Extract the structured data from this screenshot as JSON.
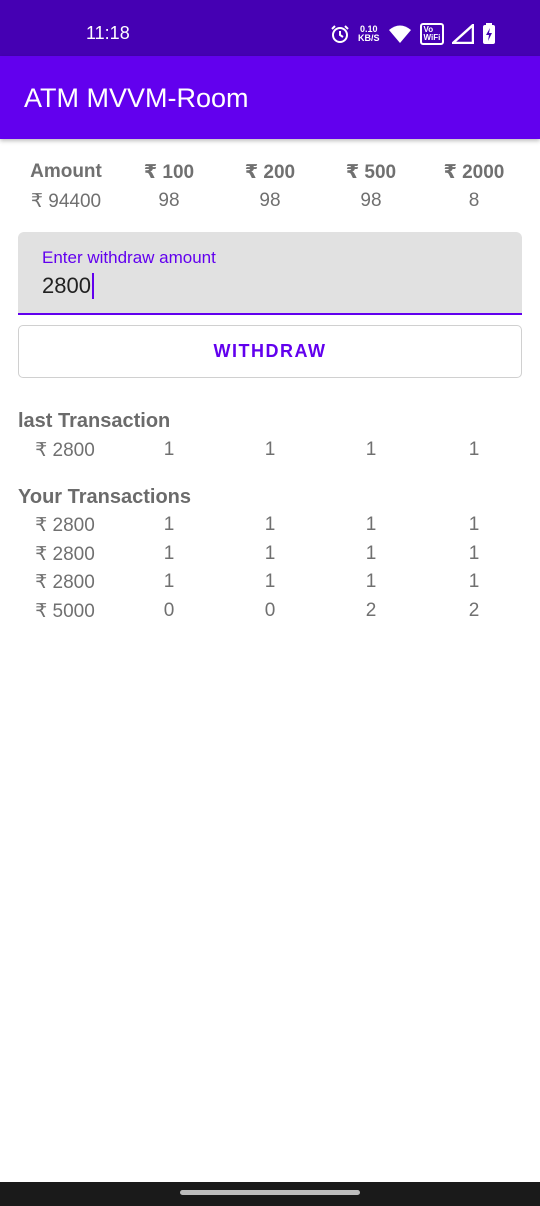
{
  "status_bar": {
    "time": "11:18",
    "net_speed_value": "0.10",
    "net_speed_unit": "KB/S",
    "vowifi_top": "Vo",
    "vowifi_bottom": "WiFi"
  },
  "app_bar": {
    "title": "ATM MVVM-Room"
  },
  "header": {
    "columns": [
      "Amount",
      "₹ 100",
      "₹ 200",
      "₹ 500",
      "₹ 2000"
    ],
    "values": [
      "₹ 94400",
      "98",
      "98",
      "98",
      "8"
    ]
  },
  "withdraw_input": {
    "label": "Enter withdraw amount",
    "value": "2800"
  },
  "withdraw_button": {
    "label": "WITHDRAW"
  },
  "last_transaction": {
    "title": "last Transaction",
    "row": [
      "₹ 2800",
      "1",
      "1",
      "1",
      "1"
    ]
  },
  "your_transactions": {
    "title": "Your Transactions",
    "rows": [
      [
        "₹ 2800",
        "1",
        "1",
        "1",
        "1"
      ],
      [
        "₹ 2800",
        "1",
        "1",
        "1",
        "1"
      ],
      [
        "₹ 2800",
        "1",
        "1",
        "1",
        "1"
      ],
      [
        "₹ 5000",
        "0",
        "0",
        "2",
        "2"
      ]
    ]
  },
  "colors": {
    "status_bar": "#4500b3",
    "app_bar": "#6200ee",
    "accent": "#6200ee",
    "text_grey": "#707070"
  }
}
